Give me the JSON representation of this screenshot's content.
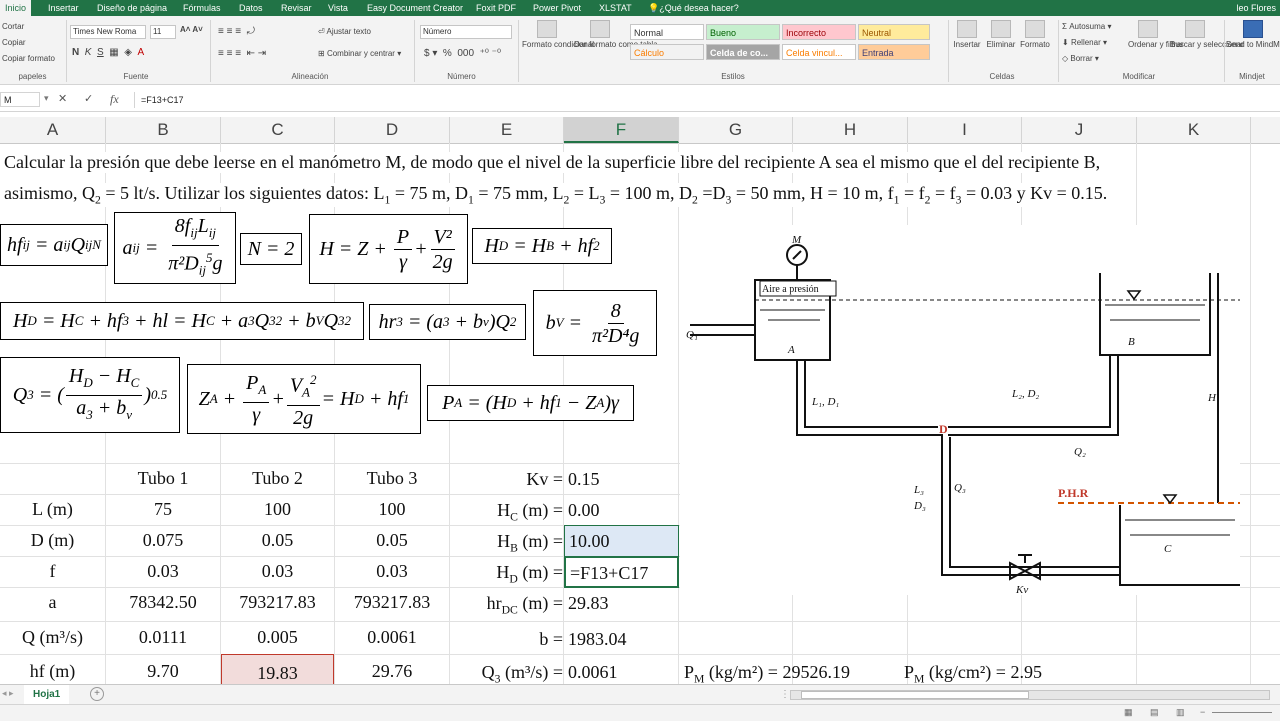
{
  "ribbon_tabs": [
    "Inicio",
    "Insertar",
    "Diseño de página",
    "Fórmulas",
    "Datos",
    "Revisar",
    "Vista",
    "Easy Document Creator",
    "Foxit PDF",
    "Power Pivot",
    "XLSTAT",
    "¿Qué desea hacer?"
  ],
  "user_name": "leo Flores",
  "clipboard": {
    "cut": "Cortar",
    "copy": "Copiar",
    "format_painter": "Copiar formato",
    "group": "papeles"
  },
  "font": {
    "name": "Times New Roma",
    "size": "11",
    "group": "Fuente"
  },
  "alignment": {
    "wrap": "Ajustar texto",
    "merge": "Combinar y centrar",
    "group": "Alineación"
  },
  "number": {
    "format": "Número",
    "group": "Número"
  },
  "styles": {
    "conditional": "Formato condicional",
    "table": "Dar formato como tabla",
    "normal": "Normal",
    "bueno": "Bueno",
    "incorrecto": "Incorrecto",
    "neutral": "Neutral",
    "calculo": "Cálculo",
    "celda_co": "Celda de co...",
    "celda_vinc": "Celda vincul...",
    "entrada": "Entrada",
    "group": "Estilos"
  },
  "cells_group": {
    "insert": "Insertar",
    "delete": "Eliminar",
    "format": "Formato",
    "group": "Celdas"
  },
  "editing": {
    "autosum": "Autosuma",
    "fill": "Rellenar",
    "clear": "Borrar",
    "sort": "Ordenar y filtrar",
    "find": "Buscar y seleccionar",
    "group": "Modificar"
  },
  "mindjet": {
    "send": "Send to MindManager",
    "group": "Mindjet"
  },
  "formula_bar": {
    "name_box": "M",
    "formula": "=F13+C17"
  },
  "columns": [
    "A",
    "B",
    "C",
    "D",
    "E",
    "F",
    "G",
    "H",
    "I",
    "J",
    "K"
  ],
  "statement": {
    "line1": "Calcular la presión que debe leerse en el manómetro M, de modo que el nivel de la superficie libre del recipiente A sea el mismo que el del recipiente B,",
    "line2a": "asimismo, Q",
    "line2sub": "2",
    "line2b": " = 5 lt/s. Utilizar los siguientes datos: L",
    "line2c": " = 75 m, D",
    "line2d": " = 75 mm, L",
    "line2e": " = L",
    "line2f": " = 100 m, D",
    "line2g": " =D",
    "line2h": " = 50 mm, H = 10 m, f",
    "line2i": " = f",
    "line2j": " = f",
    "line2k": " = 0.03 y Kv = 0.15."
  },
  "table": {
    "headers": [
      "Tubo 1",
      "Tubo 2",
      "Tubo 3"
    ],
    "rows": [
      {
        "label": "L (m)",
        "values": [
          "75",
          "100",
          "100"
        ]
      },
      {
        "label": "D (m)",
        "values": [
          "0.075",
          "0.05",
          "0.05"
        ]
      },
      {
        "label": "f",
        "values": [
          "0.03",
          "0.03",
          "0.03"
        ]
      },
      {
        "label": "a",
        "values": [
          "78342.50",
          "793217.83",
          "793217.83"
        ]
      },
      {
        "label": "Q (m³/s)",
        "values": [
          "0.0111",
          "0.005",
          "0.0061"
        ]
      },
      {
        "label": "hf (m)",
        "values": [
          "9.70",
          "19.83",
          "29.76"
        ]
      }
    ]
  },
  "params": {
    "kv_label": "Kv =",
    "kv": "0.15",
    "hc_label": "(m) =",
    "hc": "0.00",
    "hb_label": "(m) =",
    "hb": "10.00",
    "hd_label": "(m) =",
    "hd": "=F13+C17",
    "hr_label": "(m) =",
    "hr": "29.83",
    "b_label": "b =",
    "b": "1983.04",
    "q3_label": "(m³/s) =",
    "q3": "0.0061"
  },
  "results": {
    "pm1_label": "(kg/m²) =",
    "pm1": "29526.19",
    "pm2_label": "(kg/cm²) =",
    "pm2": "2.95"
  },
  "diagram_labels": {
    "m": "M",
    "aire": "Aire a presión",
    "a": "A",
    "b": "B",
    "c": "C",
    "q1": "Q₁",
    "l1d1": "L₁, D₁",
    "l2d2": "L₂, D₂",
    "q2": "Q₂",
    "d": "D",
    "phr": "P.H.R",
    "l3": "L₃",
    "d3": "D₃",
    "q3": "Q₃",
    "h": "H",
    "kv": "Kv"
  },
  "sheet_tab": "Hoja1",
  "colors": {
    "excel_green": "#217346",
    "selection": "#217346",
    "red_cell": "#c0392b"
  }
}
